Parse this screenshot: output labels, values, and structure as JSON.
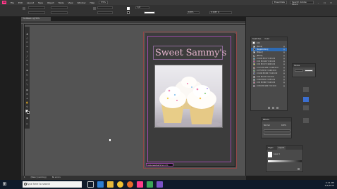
{
  "app": {
    "logo": "Id",
    "menus": [
      "File",
      "Edit",
      "Layout",
      "Type",
      "Object",
      "Table",
      "View",
      "Window",
      "Help"
    ],
    "zoom": "55%",
    "workspace": "Essentials",
    "search_placeholder": "Search Adobe Stock"
  },
  "document": {
    "tab_title": "*Untitled-1 @ 55%",
    "title_text": "Sweet Sammy's",
    "footer_text": "www.sweetsammys.com"
  },
  "control": {
    "stroke_weight": "1 pt",
    "opacity": "100%",
    "dimension": "0.1667 in"
  },
  "swatches_panel": {
    "tabs": [
      "Swatches",
      "Color"
    ],
    "tint": "100",
    "items": [
      {
        "name": "[None]",
        "color": "#ffffff",
        "selected": false
      },
      {
        "name": "[Registration]",
        "color": "#000000",
        "selected": true
      },
      {
        "name": "[Paper]",
        "color": "#ffffff",
        "selected": false
      },
      {
        "name": "[Black]",
        "color": "#000000",
        "selected": false
      },
      {
        "name": "C=100 M=0 Y=0 K=0",
        "color": "#00aeef",
        "selected": false
      },
      {
        "name": "C=0 M=100 Y=0 K=0",
        "color": "#ec008c",
        "selected": false
      },
      {
        "name": "C=0 M=0 Y=100 K=0",
        "color": "#fff200",
        "selected": false
      },
      {
        "name": "C=15 M=100 Y=100 K=0",
        "color": "#d2232a",
        "selected": false
      },
      {
        "name": "C=75 M=5 Y=100 K=0",
        "color": "#3fae49",
        "selected": false
      },
      {
        "name": "C=100 M=90 Y=10 K=0",
        "color": "#263a8c",
        "selected": false
      },
      {
        "name": "C=0 M=37 Y=0 K=0",
        "color": "#f5b3d3",
        "selected": false
      },
      {
        "name": "C=60 M=0 Y=25 K=0",
        "color": "#5fc7c7",
        "selected": false
      },
      {
        "name": "C=0 M=80 Y=10 K=0",
        "color": "#eb5594",
        "selected": false
      },
      {
        "name": "C=50 M=100 Y=0 K=0",
        "color": "#92278f",
        "selected": false
      }
    ]
  },
  "panels": {
    "stroke_title": "Stroke",
    "effects_title": "Effects",
    "effects_mode": "Normal",
    "effects_opacity": "100%",
    "layers_tabs": [
      "Pages",
      "Layers"
    ],
    "layer_name": "Layer 1"
  },
  "status": {
    "page": "1",
    "preflight": "[Basic] (working)",
    "errors": "No errors"
  },
  "taskbar": {
    "search_text": "Type here to search",
    "time": "6:41 PM",
    "date": "3/4/2019"
  }
}
